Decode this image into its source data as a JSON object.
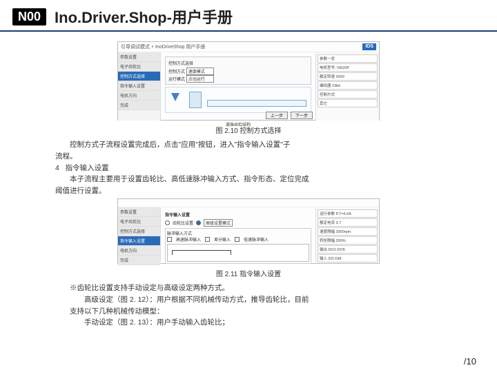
{
  "header": {
    "badge": "N00",
    "title": "Ino.Driver.Shop-用户手册"
  },
  "fig1": {
    "top_title": "引导调试模式 + InoDriveShop 用户手册",
    "ids": "IDS",
    "sidebar": [
      "参数设置",
      "电子齿轮比",
      "控制方式选择",
      "指令输入设置",
      "电机方向",
      "完成"
    ],
    "active_index": 2,
    "panel_title": "控制方式选择",
    "label1": "控制方式",
    "dd1": "速度模式",
    "label2": "运行模式",
    "dd2": "点动运行",
    "illus_caption": "滚珠丝杠结构",
    "right": [
      "参数一览",
      "电机型号: IS620P",
      "额定转速 3000",
      "编码器 23bit",
      "控制方式",
      "其它"
    ],
    "btn_prev": "上一步",
    "btn_next": "下一步",
    "caption": "图 2.10 控制方式选择"
  },
  "para1": {
    "l1": "控制方式子流程设置完成后，点击\"应用\"按钮，进入\"指令输入设置\"子",
    "l2": "流程。",
    "l3_num": "4",
    "l3_title": "指令输入设置",
    "l4": "本子流程主要用于设置齿轮比、高低速脉冲输入方式、指令形态、定位完成",
    "l5": "阈值进行设置。"
  },
  "fig2": {
    "sidebar": [
      "参数设置",
      "电子齿轮比",
      "控制方式选择",
      "指令输入设置",
      "电机方向",
      "完成"
    ],
    "active_index": 3,
    "panel_title": "指令输入设置",
    "gear_label": "齿轮比设置",
    "gear_mode": "高级设置模式",
    "pulse_title": "脉冲输入方式",
    "opt_hi": "高速脉冲输入",
    "opt_lo": "低速脉冲输入",
    "opt_mid": "差分输入",
    "right": [
      "运行参数 P.T=5.0A",
      "额定电流 3.7",
      "速度限幅 3000rpm",
      "转矩限幅 300%",
      "输出 DO1-DO5",
      "输入 DI1-DI8"
    ],
    "caption": "图 2.11 指令输入设置"
  },
  "para2": {
    "l1": "※齿轮比设置支持手动设定与高级设定两种方式。",
    "l2": "高级设定（图 2. 12）：用户根据不同机械传动方式，推导齿轮比，目前",
    "l3": "支持以下几种机械传动模型：",
    "l4": "手动设定（图 2. 13）：用户手动输入齿轮比；"
  },
  "footer": {
    "text": "/10"
  }
}
